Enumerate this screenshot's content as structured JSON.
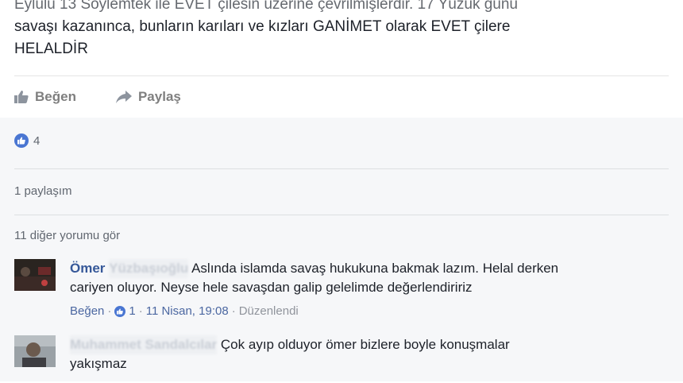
{
  "post": {
    "line1_partial": "Eylülü 13 Söylemtek ile EVET çilesin üzerine çevrilmişlerdir. 17 Yüzük günü",
    "line2": "savaşı kazanınca, bunların karıları ve kızları GANİMET olarak EVET çilere",
    "line3": "HELALDİR"
  },
  "actions": {
    "like": "Beğen",
    "share": "Paylaş"
  },
  "reactions": {
    "count": "4"
  },
  "shares_text": "1 paylaşım",
  "more_comments": "11 diğer yorumu gör",
  "comments": [
    {
      "name": "Ömer",
      "redacted_surname": "Yüzbaşıoğlu",
      "text_line1": "Aslında islamda savaş hukukuna bakmak lazım. Helal derken",
      "text_line2": "cariyen oluyor. Neyse hele savaşdan galip gelelimde değerlendiririz",
      "meta": {
        "like": "Beğen",
        "sep1": " · ",
        "likes": "1",
        "sep2": " · ",
        "time": "11 Nisan, 19:08",
        "sep3": " · ",
        "edited": "Düzenlendi"
      }
    },
    {
      "name_blurred": "Muhammet Sandalcılar",
      "text_line1": "Çok ayıp olduyor ömer bizlere boyle konuşmalar",
      "text_line2": "yakışmaz"
    }
  ],
  "colors": {
    "accent": "#365899",
    "like_blue": "#4a76d2",
    "feedback_bg": "#f6f7f9"
  },
  "icons": {
    "like": "thumbs-up-icon",
    "share": "share-arrow-icon"
  }
}
